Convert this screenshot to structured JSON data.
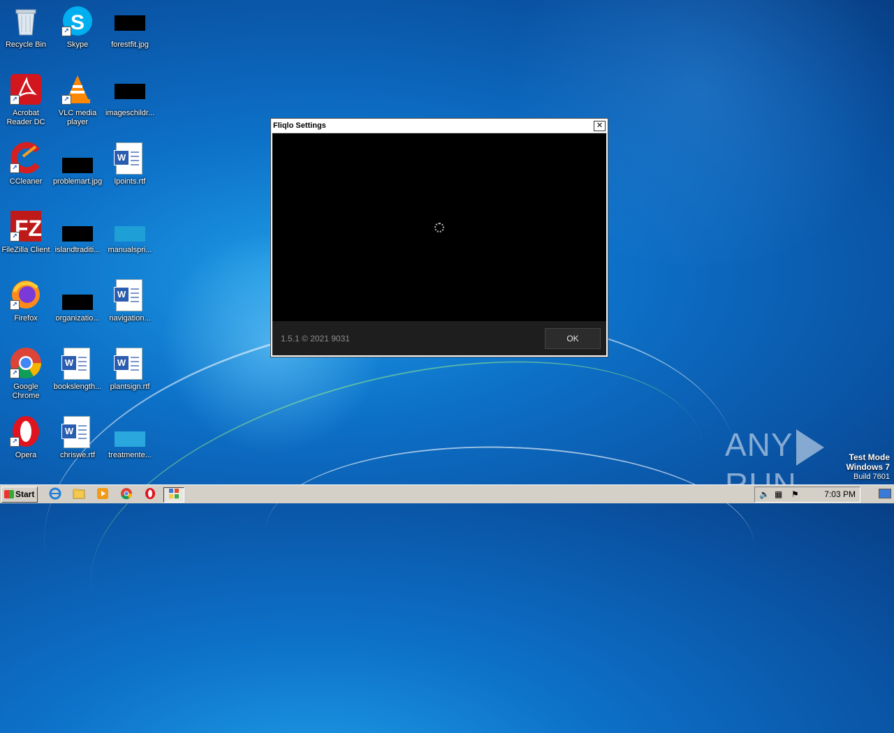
{
  "desktop": {
    "icons": [
      {
        "label": "Recycle Bin",
        "icon": "recycle-bin-icon"
      },
      {
        "label": "Skype",
        "icon": "skype-icon"
      },
      {
        "label": "forestfit.jpg",
        "icon": "image-file-icon"
      },
      {
        "label": "Acrobat Reader DC",
        "icon": "acrobat-icon"
      },
      {
        "label": "VLC media player",
        "icon": "vlc-icon"
      },
      {
        "label": "imageschildr...",
        "icon": "image-file-icon"
      },
      {
        "label": "CCleaner",
        "icon": "ccleaner-icon"
      },
      {
        "label": "problemart.jpg",
        "icon": "image-file-icon"
      },
      {
        "label": "lpoints.rtf",
        "icon": "word-document-icon"
      },
      {
        "label": "FileZilla Client",
        "icon": "filezilla-icon"
      },
      {
        "label": "islandtraditi...",
        "icon": "image-file-icon"
      },
      {
        "label": "manualspri...",
        "icon": "image-file-icon"
      },
      {
        "label": "Firefox",
        "icon": "firefox-icon"
      },
      {
        "label": "organizatio...",
        "icon": "image-file-icon"
      },
      {
        "label": "navigation...",
        "icon": "word-document-icon"
      },
      {
        "label": "Google Chrome",
        "icon": "chrome-icon"
      },
      {
        "label": "bookslength...",
        "icon": "word-document-icon"
      },
      {
        "label": "plantsign.rtf",
        "icon": "word-document-icon"
      },
      {
        "label": "Opera",
        "icon": "opera-icon"
      },
      {
        "label": "chriswe.rtf",
        "icon": "word-document-icon"
      },
      {
        "label": "treatmente...",
        "icon": "image-file-icon"
      }
    ]
  },
  "dialog": {
    "title": "Fliqlo Settings",
    "close_label": "✕",
    "version_text": "1.5.1 © 2021 9031",
    "ok_label": "OK"
  },
  "watermark": {
    "brand_left": "ANY",
    "brand_right": "RUN",
    "test_mode": "Test Mode",
    "os": "Windows 7",
    "build": "Build 7601"
  },
  "taskbar": {
    "start_label": "Start",
    "clock": "7:03 PM",
    "pinned": [
      "internet-explorer-icon",
      "explorer-folder-icon",
      "media-player-icon",
      "chrome-icon",
      "opera-icon",
      "fliqlo-app-icon"
    ]
  }
}
